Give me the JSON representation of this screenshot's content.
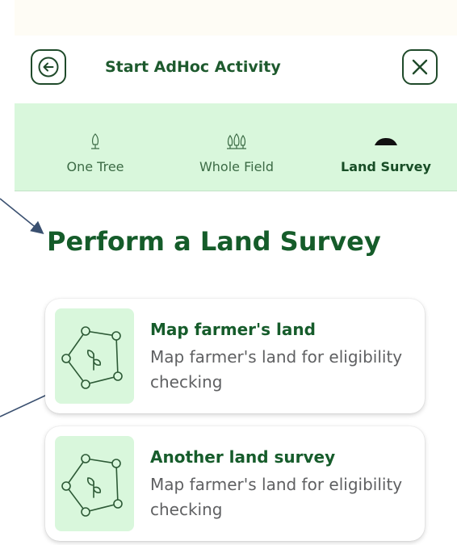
{
  "header": {
    "title": "Start AdHoc Activity",
    "back_icon": "arrow-left-icon",
    "close_icon": "close-icon"
  },
  "tabs": [
    {
      "label": "One Tree",
      "icon": "tree-icon",
      "active": false
    },
    {
      "label": "Whole Field",
      "icon": "trees-icon",
      "active": false
    },
    {
      "label": "Land Survey",
      "icon": "land-icon",
      "active": true
    }
  ],
  "main": {
    "title": "Perform a Land Survey",
    "cards": [
      {
        "title": "Map farmer's land",
        "description": "Map farmer's land for eligibility checking",
        "icon": "plot-map-icon"
      },
      {
        "title": "Another land survey",
        "description": "Map farmer's land for eligibility checking",
        "icon": "plot-map-icon"
      }
    ]
  },
  "colors": {
    "accent": "#155c2a",
    "tab_bar": "#d9f7dc",
    "thumb_bg": "#d9f7dc",
    "arrow": "#3a5070"
  }
}
